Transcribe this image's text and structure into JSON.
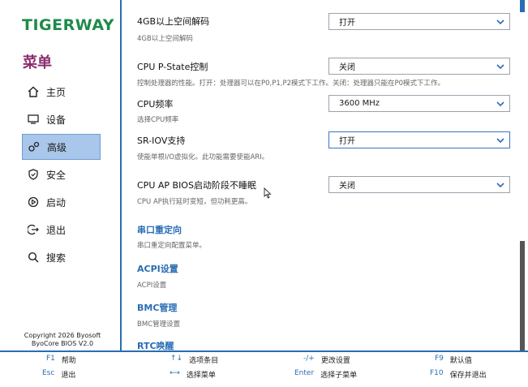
{
  "brand": {
    "logo": "TIGERWAY",
    "logo_color": "#1f8a4a"
  },
  "sidebar": {
    "menu_title": "菜单",
    "items": [
      {
        "label": "主页",
        "icon": "home-icon",
        "active": false
      },
      {
        "label": "设备",
        "icon": "device-icon",
        "active": false
      },
      {
        "label": "高级",
        "icon": "advanced-icon",
        "active": true
      },
      {
        "label": "安全",
        "icon": "shield-icon",
        "active": false
      },
      {
        "label": "启动",
        "icon": "boot-icon",
        "active": false
      },
      {
        "label": "退出",
        "icon": "exit-icon",
        "active": false
      },
      {
        "label": "搜索",
        "icon": "search-icon",
        "active": false
      }
    ],
    "copyright_line1": "Copyright 2026 Byosoft",
    "copyright_line2": "ByoCore BIOS V2.0"
  },
  "settings": [
    {
      "label": "4GB以上空间解码",
      "help": "4GB以上空间解码",
      "value": "打开"
    },
    {
      "label": "CPU P-State控制",
      "help": "控制处理器的性能。打开：处理器可以在P0,P1,P2模式下工作。关闭：处理器只能在P0模式下工作。",
      "value": "关闭"
    },
    {
      "label": "CPU频率",
      "help": "选择CPU频率",
      "value": "3600 MHz"
    },
    {
      "label": "SR-IOV支持",
      "help": "使能单根I/O虚拟化。此功能需要使能ARI。",
      "value": "打开"
    },
    {
      "label": "CPU AP BIOS启动阶段不睡眠",
      "help": "CPU AP执行延时变短，但功耗更高。",
      "value": "关闭"
    }
  ],
  "links": [
    {
      "label": "串口重定向",
      "help": "串口重定向配置菜单。"
    },
    {
      "label": "ACPI设置",
      "help": "ACPI设置"
    },
    {
      "label": "BMC管理",
      "help": "BMC管理设置"
    },
    {
      "label": "RTC唤醒",
      "help": ""
    }
  ],
  "footer": {
    "f1_key": "F1",
    "f1_text": "帮助",
    "esc_key": "Esc",
    "esc_text": "退出",
    "updown_key": "↑↓",
    "updown_text": "选项条目",
    "leftright_key": "⟷",
    "leftright_text": "选择菜单",
    "pm_key": "-/+",
    "pm_text": "更改设置",
    "enter_key": "Enter",
    "enter_text": "选择子菜单",
    "f9_key": "F9",
    "f9_text": "默认值",
    "f10_key": "F10",
    "f10_text": "保存并退出"
  },
  "colors": {
    "accent": "#2a6db5",
    "active_bg": "#a9c7ea",
    "menu_title": "#8a2d6e"
  }
}
